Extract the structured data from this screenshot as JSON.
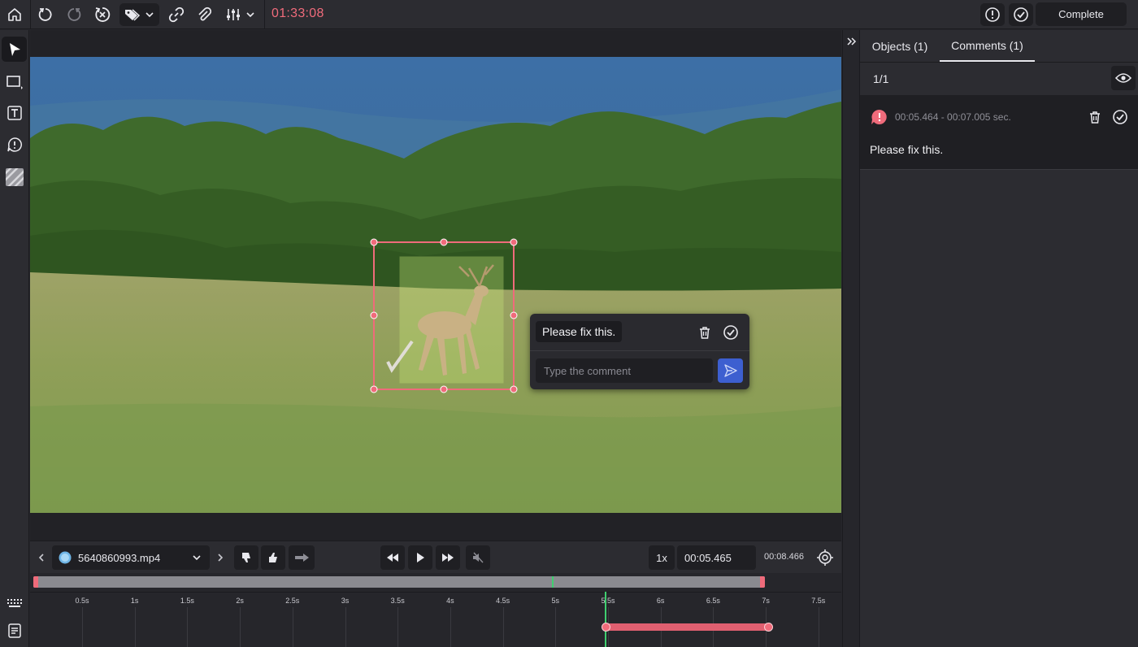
{
  "toolbar": {
    "timer": "01:33:08",
    "complete_label": "Complete"
  },
  "popup": {
    "comment_text": "Please fix this.",
    "input_placeholder": "Type the comment"
  },
  "panel": {
    "tabs": [
      {
        "label": "Objects (1)"
      },
      {
        "label": "Comments (1)"
      }
    ],
    "active_tab": "Comments (1)",
    "counter": "1/1",
    "comment": {
      "time_range": "00:05.464 - 00:07.005 sec.",
      "text": "Please fix this."
    }
  },
  "player": {
    "file_name": "5640860993.mp4",
    "speed": "1x",
    "current_time": "00:05.465",
    "duration": "00:08.466"
  },
  "timeline": {
    "ticks": [
      "0.5s",
      "1s",
      "1.5s",
      "2s",
      "2.5s",
      "3s",
      "3.5s",
      "4s",
      "4.5s",
      "5s",
      "5.5s",
      "6s",
      "6.5s",
      "7s",
      "7.5s"
    ]
  },
  "colors": {
    "accent_red": "#ef6b7b",
    "accent_blue": "#3d5fd0",
    "playhead_green": "#3fcf6f"
  }
}
